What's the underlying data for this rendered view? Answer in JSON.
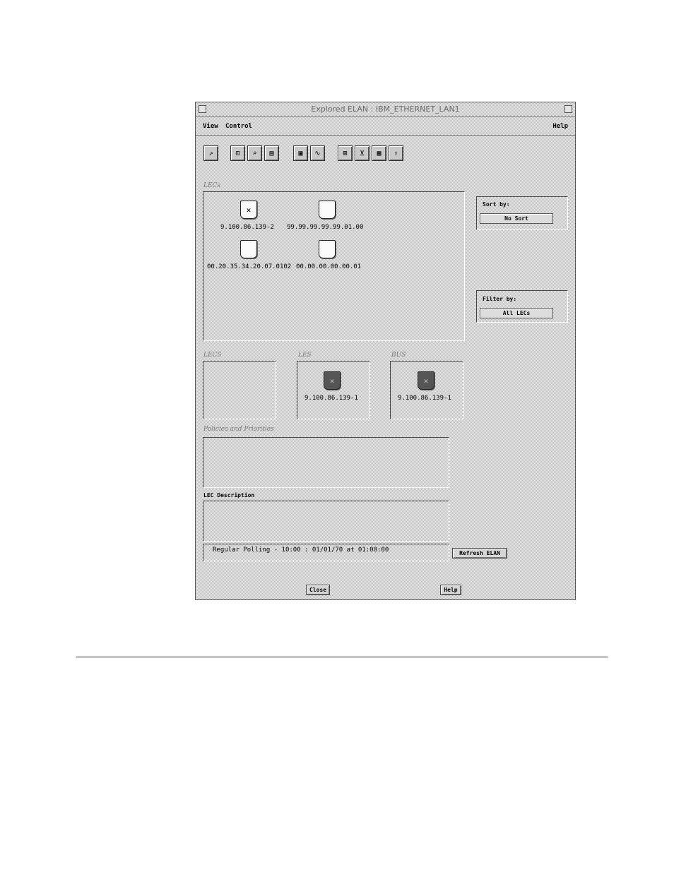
{
  "window": {
    "title": "Explored ELAN : IBM_ETHERNET_LAN1"
  },
  "menubar": {
    "view": "View",
    "control": "Control",
    "help": "Help"
  },
  "toolbar": {
    "icons": [
      "arrow-icon",
      "lec-icon",
      "search-icon",
      "list-icon",
      "monitor-icon",
      "graph-icon",
      "lec-icon",
      "lec-icon",
      "list-icon",
      "up-icon"
    ]
  },
  "lecs_section": {
    "label": "LECs",
    "items": [
      {
        "address": "9.100.86.139-2",
        "glyph": "✕",
        "variant": "light"
      },
      {
        "address": "99.99.99.99.99.01.00",
        "glyph": "",
        "variant": "light"
      },
      {
        "address": "00.20.35.34.20.07.0102",
        "glyph": "",
        "variant": "light"
      },
      {
        "address": "00.00.00.00.00.01",
        "glyph": "",
        "variant": "light"
      }
    ]
  },
  "sort": {
    "label": "Sort by:",
    "value": "No Sort"
  },
  "filter": {
    "label": "Filter by:",
    "value": "All LECs"
  },
  "lecs_group": {
    "label": "LECS"
  },
  "les_group": {
    "label": "LES",
    "address": "9.100.86.139-1"
  },
  "bus_group": {
    "label": "BUS",
    "address": "9.100.86.139-1"
  },
  "policies": {
    "label": "Policies and Priorities"
  },
  "lec_description": {
    "label": "LEC Description"
  },
  "status": {
    "text": "Regular Polling - 10:00 : 01/01/70 at 01:00:00"
  },
  "buttons": {
    "refresh": "Refresh ELAN",
    "close": "Close",
    "help": "Help"
  }
}
